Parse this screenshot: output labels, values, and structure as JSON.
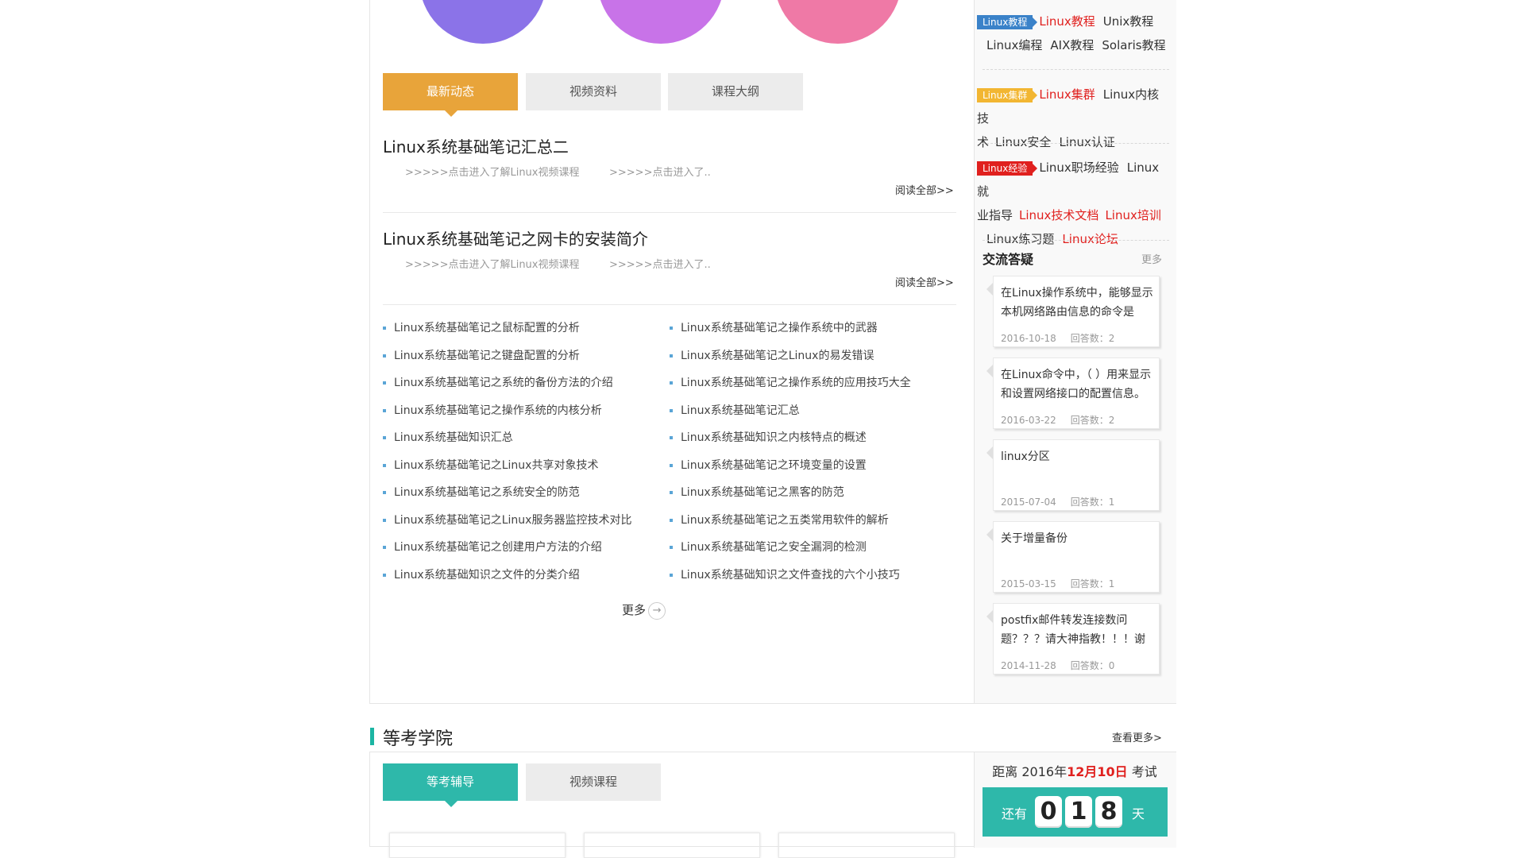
{
  "circles": [
    {
      "color": "#8b73e8"
    },
    {
      "color": "#c873e8"
    },
    {
      "color": "#ef79a6"
    }
  ],
  "tabs": [
    {
      "label": "最新动态",
      "active": true,
      "color": "#e8a43a"
    },
    {
      "label": "视频资料",
      "active": false
    },
    {
      "label": "课程大纲",
      "active": false
    }
  ],
  "articles": [
    {
      "title": "Linux系统基础笔记汇总二",
      "link1": ">>>>>点击进入了解Linux视频课程",
      "link2": ">>>>>点击进入了..",
      "readall": "阅读全部>>"
    },
    {
      "title": "Linux系统基础笔记之网卡的安装简介",
      "link1": ">>>>>点击进入了解Linux视频课程",
      "link2": ">>>>>点击进入了..",
      "readall": "阅读全部>>"
    }
  ],
  "list_left": [
    "Linux系统基础笔记之鼠标配置的分析",
    "Linux系统基础笔记之键盘配置的分析",
    "Linux系统基础笔记之系统的备份方法的介绍",
    "Linux系统基础笔记之操作系统的内核分析",
    "Linux系统基础知识汇总",
    "Linux系统基础笔记之Linux共享对象技术",
    "Linux系统基础笔记之系统安全的防范",
    "Linux系统基础笔记之Linux服务器监控技术对比",
    "Linux系统基础笔记之创建用户方法的介绍",
    "Linux系统基础知识之文件的分类介绍"
  ],
  "list_right": [
    "Linux系统基础笔记之操作系统中的武器",
    "Linux系统基础笔记之Linux的易发错误",
    "Linux系统基础笔记之操作系统的应用技巧大全",
    "Linux系统基础笔记汇总",
    "Linux系统基础知识之内核特点的概述",
    "Linux系统基础笔记之环境变量的设置",
    "Linux系统基础笔记之黑客的防范",
    "Linux系统基础笔记之五类常用软件的解析",
    "Linux系统基础笔记之安全漏洞的检测",
    "Linux系统基础知识之文件查找的六个小技巧"
  ],
  "more_label": "更多",
  "tag_groups": [
    {
      "tag": "Linux教程",
      "tag_color": "#3a82c9",
      "line1": [
        {
          "text": "Linux教程",
          "red": true
        },
        {
          "text": "Unix教程",
          "red": false
        }
      ],
      "line2": [
        {
          "text": "Linux编程",
          "red": false
        },
        {
          "text": "AIX教程",
          "red": false
        },
        {
          "text": "Solaris教程",
          "red": false
        }
      ]
    },
    {
      "tag": "Linux集群",
      "tag_color": "#f2b632",
      "line1": [
        {
          "text": "Linux集群",
          "red": true
        },
        {
          "text": "Linux内核技",
          "red": false
        }
      ],
      "line2": [
        {
          "text": "术",
          "red": false
        },
        {
          "text": "Linux安全",
          "red": false
        },
        {
          "text": "Linux认证",
          "red": false
        }
      ]
    },
    {
      "tag": "Linux经验",
      "tag_color": "#e0201e",
      "line1": [
        {
          "text": "Linux职场经验",
          "red": false
        },
        {
          "text": "Linux就",
          "red": false
        }
      ],
      "line2": [
        {
          "text": "业指导",
          "red": false
        },
        {
          "text": "Linux技术文档",
          "red": true
        },
        {
          "text": "Linux培训",
          "red": true
        }
      ],
      "line3": [
        {
          "text": "Linux练习题",
          "red": false
        },
        {
          "text": "Linux论坛",
          "red": true
        }
      ]
    }
  ],
  "qa": {
    "title": "交流答疑",
    "more": "更多",
    "items": [
      {
        "q": "在Linux操作系统中，能够显示本机网络路由信息的命令是",
        "date": "2016-10-18",
        "answers": "回答数：2"
      },
      {
        "q": "在Linux命令中，（ ）用来显示和设置网络接口的配置信息。",
        "date": "2016-03-22",
        "answers": "回答数：2"
      },
      {
        "q": "linux分区",
        "date": "2015-07-04",
        "answers": "回答数：1"
      },
      {
        "q": "关于增量备份",
        "date": "2015-03-15",
        "answers": "回答数：1"
      },
      {
        "q": "postfix邮件转发连接数问题？？？请大神指教！！！谢",
        "date": "2014-11-28",
        "answers": "回答数：0"
      }
    ]
  },
  "section2": {
    "title": "等考学院",
    "more": "查看更多>",
    "tabs": [
      {
        "label": "等考辅导",
        "active": true,
        "color": "#2eb8aa"
      },
      {
        "label": "视频课程",
        "active": false
      }
    ],
    "countdown": {
      "prefix": "距离 2016年",
      "date": "12月10日",
      "suffix": " 考试",
      "left_label": "还有",
      "digits": [
        "0",
        "1",
        "8"
      ],
      "unit": "天"
    }
  }
}
